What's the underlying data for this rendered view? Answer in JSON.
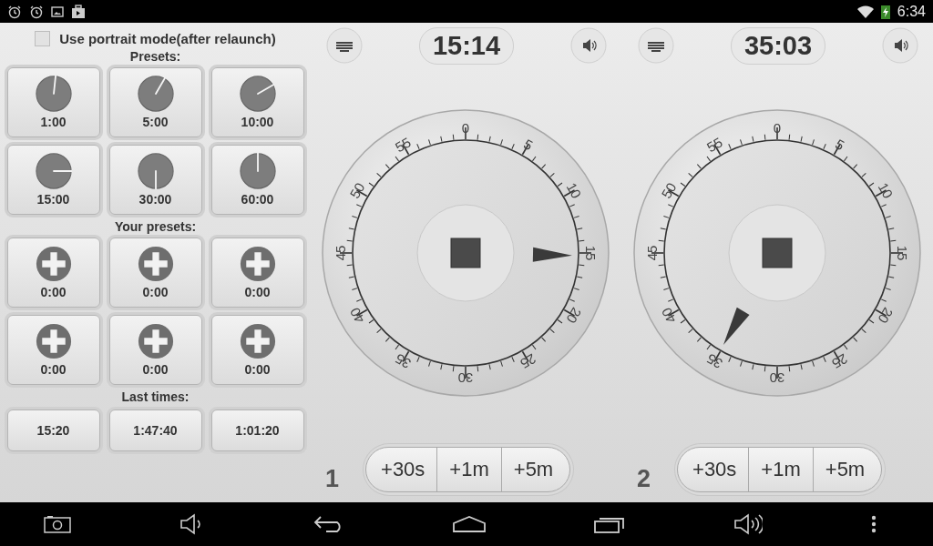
{
  "status_bar": {
    "time": "6:34"
  },
  "portrait_option": {
    "label": "Use portrait mode(after relaunch)",
    "checked": false
  },
  "preset_sections": [
    {
      "heading": "Presets:",
      "items": [
        {
          "kind": "clock",
          "label": "1:00"
        },
        {
          "kind": "clock",
          "label": "5:00"
        },
        {
          "kind": "clock",
          "label": "10:00"
        },
        {
          "kind": "clock",
          "label": "15:00"
        },
        {
          "kind": "clock",
          "label": "30:00"
        },
        {
          "kind": "clock",
          "label": "60:00"
        }
      ]
    },
    {
      "heading": "Your presets:",
      "items": [
        {
          "kind": "add",
          "label": "0:00"
        },
        {
          "kind": "add",
          "label": "0:00"
        },
        {
          "kind": "add",
          "label": "0:00"
        },
        {
          "kind": "add",
          "label": "0:00"
        },
        {
          "kind": "add",
          "label": "0:00"
        },
        {
          "kind": "add",
          "label": "0:00"
        }
      ]
    },
    {
      "heading": "Last times:",
      "items": [
        {
          "kind": "plain",
          "label": "15:20"
        },
        {
          "kind": "plain",
          "label": "1:47:40"
        },
        {
          "kind": "plain",
          "label": "1:01:20"
        }
      ]
    }
  ],
  "timers": [
    {
      "number": "1",
      "time": "15:14",
      "dial_numbers": [
        "0",
        "5",
        "10",
        "15",
        "20",
        "25",
        "30",
        "35",
        "40",
        "45",
        "50",
        "55"
      ],
      "buttons": [
        "+30s",
        "+1m",
        "+5m"
      ]
    },
    {
      "number": "2",
      "time": "35:03",
      "dial_numbers": [
        "0",
        "5",
        "10",
        "15",
        "20",
        "25",
        "30",
        "35",
        "40",
        "45",
        "50",
        "55"
      ],
      "buttons": [
        "+30s",
        "+1m",
        "+5m"
      ]
    }
  ]
}
